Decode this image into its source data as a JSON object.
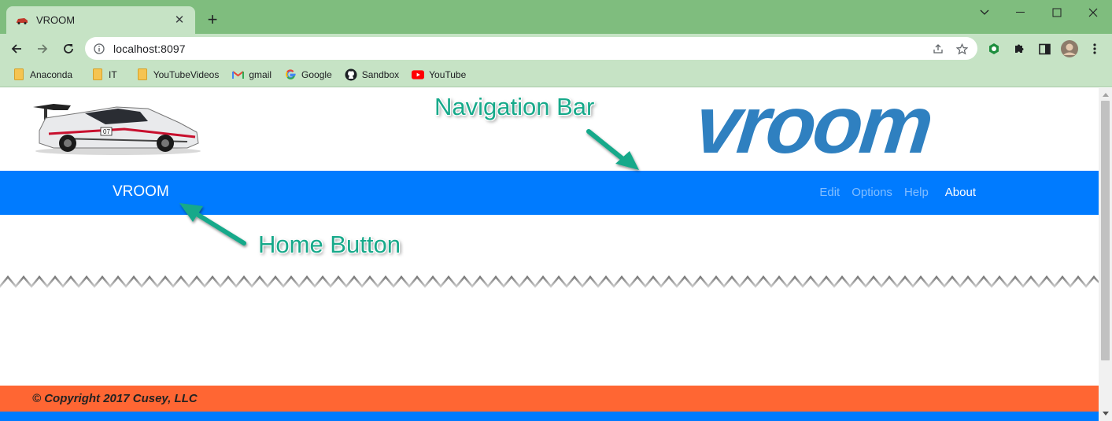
{
  "browser": {
    "tab": {
      "title": "VROOM",
      "favicon": "car-favicon"
    },
    "new_tab_label": "+",
    "window_controls": [
      "chevron-down-icon",
      "minimize-icon",
      "maximize-icon",
      "close-icon"
    ],
    "url": "localhost:8097",
    "bookmarks": [
      {
        "label": "Anaconda",
        "icon": "folder-icon"
      },
      {
        "label": "IT",
        "icon": "folder-icon"
      },
      {
        "label": "YouTubeVideos",
        "icon": "folder-icon"
      },
      {
        "label": "gmail",
        "icon": "gmail-icon"
      },
      {
        "label": "Google",
        "icon": "google-icon"
      },
      {
        "label": "Sandbox",
        "icon": "github-icon"
      },
      {
        "label": "YouTube",
        "icon": "youtube-icon"
      }
    ]
  },
  "page": {
    "logo_text": "vroom",
    "navbar": {
      "brand": "VROOM",
      "links": [
        {
          "label": "Edit",
          "active": false
        },
        {
          "label": "Options",
          "active": false
        },
        {
          "label": "Help",
          "active": false
        },
        {
          "label": "About",
          "active": true
        }
      ]
    },
    "annotations": {
      "navigation_bar": "Navigation Bar",
      "home_button": "Home Button"
    },
    "footer": {
      "copyright": "© Copyright 2017 Cusey, LLC"
    }
  },
  "colors": {
    "navbar": "#007bff",
    "footer": "#ff6633",
    "callout": "#17a98a",
    "logo": "#2f80c0",
    "chrome": "#c6e3c5"
  }
}
